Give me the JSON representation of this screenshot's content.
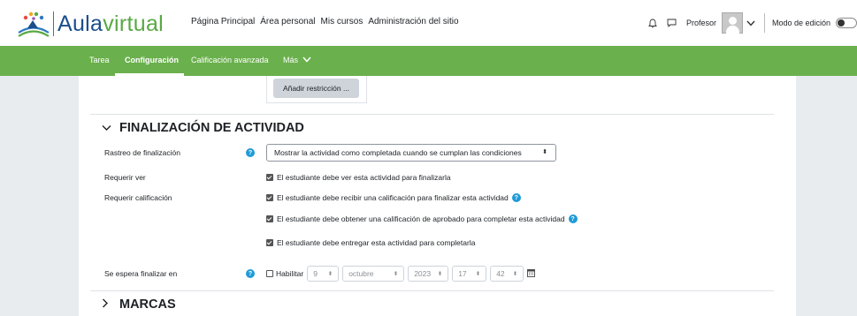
{
  "brand": {
    "name_part1": "Aula",
    "name_part2": "virtual"
  },
  "primary_nav": [
    "Página Principal",
    "Área personal",
    "Mis cursos",
    "Administración del sitio"
  ],
  "user": {
    "name": "Profesor",
    "edit_mode_label": "Modo de edición"
  },
  "secondary_nav": {
    "tab_task": "Tarea",
    "tab_settings": "Configuración",
    "tab_grading": "Calificación avanzada",
    "tab_more": "Más"
  },
  "restrictions": {
    "add_button": "Añadir restricción ..."
  },
  "completion": {
    "heading": "FINALIZACIÓN DE ACTIVIDAD",
    "tracking_label": "Rastreo de finalización",
    "tracking_value": "Mostrar la actividad como completada cuando se cumplan las condiciones",
    "require_view_label": "Requerir ver",
    "require_view_text": "El estudiante debe ver esta actividad para finalizarla",
    "require_grade_label": "Requerir calificación",
    "require_grade_text": "El estudiante debe recibir una calificación para finalizar esta actividad",
    "require_pass_text": "El estudiante debe obtener una calificación de aprobado para completar esta actividad",
    "require_submit_text": "El estudiante debe entregar esta actividad para completarla",
    "expected_label": "Se espera finalizar en",
    "enable_label": "Habilitar",
    "date": {
      "day": "9",
      "month": "octubre",
      "year": "2023",
      "hour": "17",
      "minute": "42"
    }
  },
  "tags": {
    "heading": "MARCAS"
  }
}
